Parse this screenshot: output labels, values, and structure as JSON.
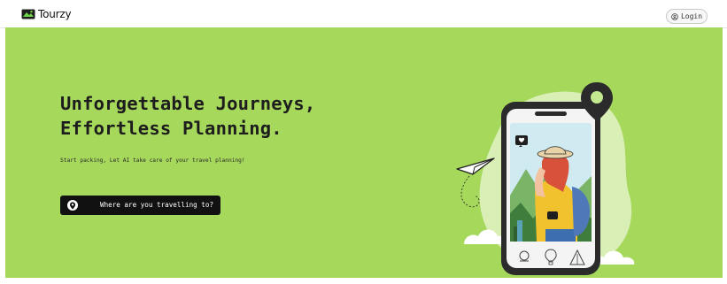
{
  "header": {
    "brand": {
      "name": "Tourzy",
      "icon": "tourzy-logo-icon"
    },
    "login": {
      "label": "Login",
      "icon": "user-circle-icon"
    }
  },
  "hero": {
    "title_line1": "Unforgettable Journeys,",
    "title_line2": "Effortless Planning.",
    "subtitle": "Start packing, Let AI take care of your travel planning!",
    "search_button": {
      "label": "Where are you travelling to?",
      "icon": "location-pin-icon"
    },
    "illustration": {
      "description_icon": "phone-traveler-illustration",
      "nav_icons": [
        "map-icon",
        "hot-air-balloon-icon",
        "tent-icon"
      ]
    }
  },
  "colors": {
    "hero_background": "#a6d85c",
    "button_background": "#111111",
    "accent_yellow": "#f2c12e",
    "brand_green": "#3d9a3d"
  }
}
